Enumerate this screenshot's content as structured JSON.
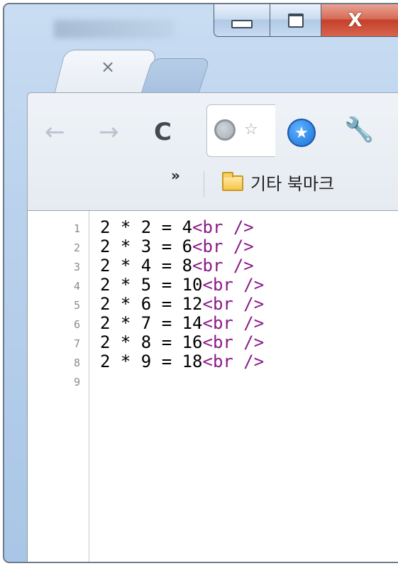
{
  "window": {
    "caption_buttons": {
      "minimize": "minimize-icon",
      "maximize": "maximize-icon",
      "close": "close-icon"
    },
    "close_glyph": "X"
  },
  "tab": {
    "close_glyph": "×"
  },
  "toolbar": {
    "back_icon": "←",
    "forward_icon": "→",
    "reload_icon": "C",
    "wrench_icon": "wrench-icon"
  },
  "bookmarks_bar": {
    "overflow_label": "»",
    "other_bookmarks_label": "기타 북마크"
  },
  "source_view": {
    "lines": [
      {
        "number": "1",
        "text": "2 * 2 = 4",
        "tag": "<br />"
      },
      {
        "number": "2",
        "text": "2 * 3 = 6",
        "tag": "<br />"
      },
      {
        "number": "3",
        "text": "2 * 4 = 8",
        "tag": "<br />"
      },
      {
        "number": "4",
        "text": "2 * 5 = 10",
        "tag": "<br />"
      },
      {
        "number": "5",
        "text": "2 * 6 = 12",
        "tag": "<br />"
      },
      {
        "number": "6",
        "text": "2 * 7 = 14",
        "tag": "<br />"
      },
      {
        "number": "7",
        "text": "2 * 8 = 16",
        "tag": "<br />"
      },
      {
        "number": "8",
        "text": "2 * 9 = 18",
        "tag": "<br />"
      },
      {
        "number": "9",
        "text": "",
        "tag": ""
      }
    ],
    "colors": {
      "text": "#000000",
      "tag": "#8a1a88",
      "line_number": "#8a8a8a"
    }
  }
}
